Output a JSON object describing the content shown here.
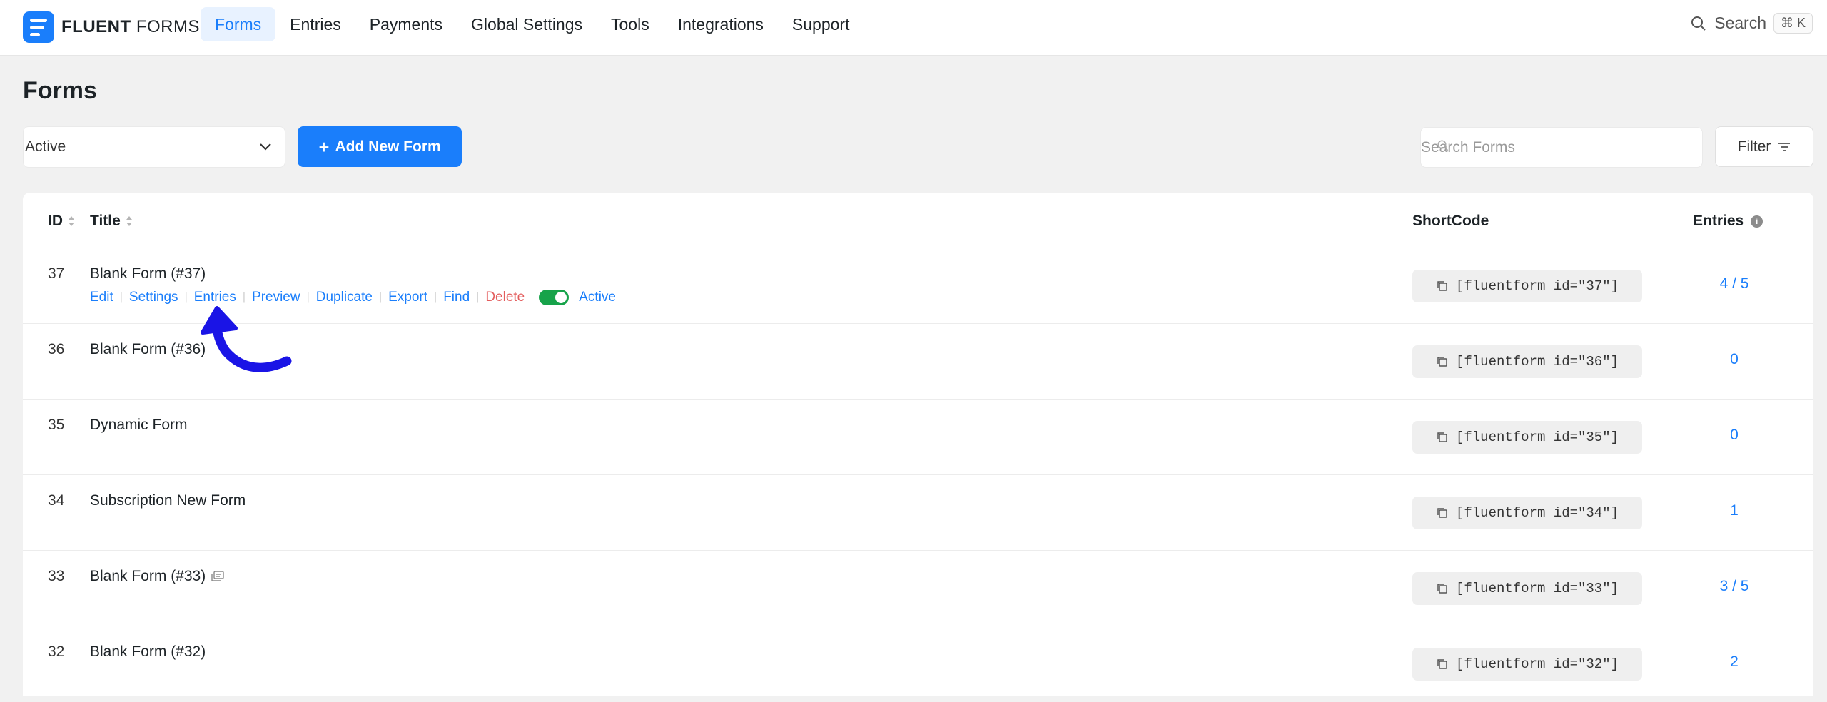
{
  "brand": {
    "name_bold": "FLUENT",
    "name_thin": "FORMS"
  },
  "nav": [
    {
      "label": "Forms",
      "active": true
    },
    {
      "label": "Entries",
      "active": false
    },
    {
      "label": "Payments",
      "active": false
    },
    {
      "label": "Global Settings",
      "active": false
    },
    {
      "label": "Tools",
      "active": false
    },
    {
      "label": "Integrations",
      "active": false
    },
    {
      "label": "Support",
      "active": false
    }
  ],
  "top_search": {
    "label": "Search",
    "shortcut": "⌘ K"
  },
  "page": {
    "title": "Forms"
  },
  "toolbar": {
    "status_value": "Active",
    "add_label": "Add New Form",
    "search_placeholder": "Search Forms",
    "filter_label": "Filter"
  },
  "table": {
    "headers": {
      "id": "ID",
      "title": "Title",
      "shortcode": "ShortCode",
      "entries": "Entries"
    },
    "row_actions": [
      "Edit",
      "Settings",
      "Entries",
      "Preview",
      "Duplicate",
      "Export",
      "Find",
      "Delete"
    ],
    "status_label": "Active",
    "rows": [
      {
        "id": "37",
        "title": "Blank Form (#37)",
        "shortcode": "[fluentform id=\"37\"]",
        "entries": "4 / 5"
      },
      {
        "id": "36",
        "title": "Blank Form (#36)",
        "shortcode": "[fluentform id=\"36\"]",
        "entries": "0"
      },
      {
        "id": "35",
        "title": "Dynamic Form",
        "shortcode": "[fluentform id=\"35\"]",
        "entries": "0"
      },
      {
        "id": "34",
        "title": "Subscription New Form",
        "shortcode": "[fluentform id=\"34\"]",
        "entries": "1"
      },
      {
        "id": "33",
        "title": "Blank Form (#33)",
        "shortcode": "[fluentform id=\"33\"]",
        "entries": "3 / 5"
      },
      {
        "id": "32",
        "title": "Blank Form (#32)",
        "shortcode": "[fluentform id=\"32\"]",
        "entries": "2"
      }
    ]
  },
  "colors": {
    "primary": "#1a7efb",
    "danger": "#e35d5d",
    "toggle_on": "#17a34a",
    "annotation": "#1a14e6"
  }
}
